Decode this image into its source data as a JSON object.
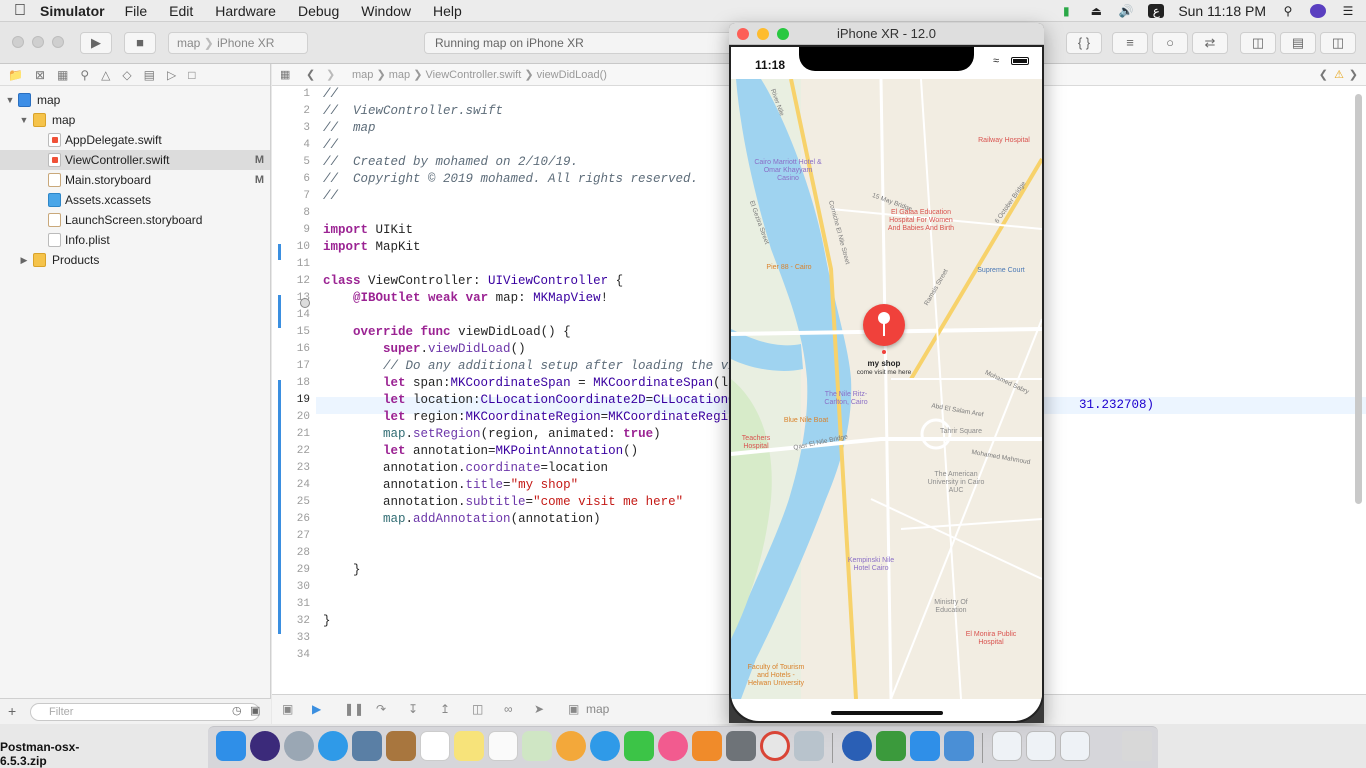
{
  "menubar": {
    "app_name": "Simulator",
    "menus": [
      "File",
      "Edit",
      "Hardware",
      "Debug",
      "Window",
      "Help"
    ],
    "clock": "Sun 11:18 PM",
    "input_source": "ع"
  },
  "toolbar": {
    "scheme": "map",
    "device": "iPhone XR",
    "activity": "Running map on iPhone XR"
  },
  "navigator": {
    "items": [
      {
        "label": "map",
        "badge": ""
      },
      {
        "label": "map",
        "badge": ""
      },
      {
        "label": "AppDelegate.swift",
        "badge": ""
      },
      {
        "label": "ViewController.swift",
        "badge": "M"
      },
      {
        "label": "Main.storyboard",
        "badge": "M"
      },
      {
        "label": "Assets.xcassets",
        "badge": ""
      },
      {
        "label": "LaunchScreen.storyboard",
        "badge": ""
      },
      {
        "label": "Info.plist",
        "badge": ""
      },
      {
        "label": "Products",
        "badge": ""
      }
    ],
    "filter_placeholder": "Filter"
  },
  "jumpbar": {
    "crumbs": [
      "map",
      "map",
      "ViewController.swift",
      "viewDidLoad()"
    ]
  },
  "editor": {
    "current_line": "19",
    "line_numbers": [
      "1",
      "2",
      "3",
      "4",
      "5",
      "6",
      "7",
      "8",
      "9",
      "10",
      "11",
      "12",
      "13",
      "14",
      "15",
      "16",
      "17",
      "18",
      "19",
      "20",
      "21",
      "22",
      "23",
      "24",
      "25",
      "26",
      "27",
      "28",
      "29",
      "30",
      "31",
      "32",
      "33",
      "34"
    ],
    "overflow_value": "31.232708)",
    "bottom_target": "map"
  },
  "simulator": {
    "window_title": "iPhone XR - 12.0",
    "status_time": "11:18",
    "annotation_title": "my shop",
    "annotation_subtitle": "come visit me here",
    "map_labels": [
      "River Nile",
      "Railway Hospital",
      "Cairo Marriott Hotel & Omar Khayyam Casino",
      "15 May Bridge",
      "6 October Bridge",
      "El Galaa Education Hospital For Women And Babies And Birth",
      "Supreme Court",
      "Pier 88 - Cairo",
      "Ramsis Street",
      "The Nile Ritz-Carlton, Cairo",
      "Blue Nile Boat",
      "Teachers Hospital",
      "Qasr El Nile Bridge",
      "Mohamed Mahmoud",
      "The American University in Cairo AUC",
      "Tahrir Square",
      "Kempinski Nile Hotel Cairo",
      "Ministry Of Education",
      "El Monira Public Hospital",
      "Faculty of Tourism and Hotels - Helwan University",
      "Corniche El Nile Street",
      "El Gezira Street",
      "Mohamed Sabry",
      "Abd El Salam Aref"
    ]
  },
  "dock": {
    "desktop_file": "Postman-osx-6.5.3.zip"
  }
}
